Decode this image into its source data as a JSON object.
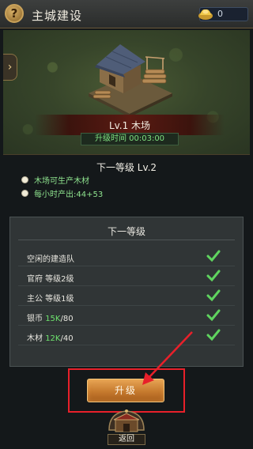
{
  "header": {
    "help_icon_glyph": "?",
    "title": "主城建设",
    "gold_value": "0"
  },
  "building": {
    "name": "Lv.1 木场",
    "upgrade_time": "升级时间 00:03:00"
  },
  "next_level": {
    "title": "下一等级 Lv.2",
    "bullets": [
      "木场可生产木材",
      "每小时产出:44+53"
    ]
  },
  "requirements": {
    "title": "下一等级",
    "rows": [
      {
        "label": "空闲的建造队",
        "met": true
      },
      {
        "label": "官府 等级2级",
        "met": true
      },
      {
        "label": "主公 等级1级",
        "met": true
      },
      {
        "label_prefix": "银币 ",
        "label_have": "15K",
        "label_suffix": "/80",
        "met": true
      },
      {
        "label_prefix": "木材 ",
        "label_have": "12K",
        "label_suffix": "/40",
        "met": true
      }
    ]
  },
  "actions": {
    "upgrade_label": "升级",
    "return_label": "返回"
  },
  "colors": {
    "check": "#5fd45f",
    "highlight_red": "#e8202a",
    "button_orange": "#c67a2e"
  }
}
